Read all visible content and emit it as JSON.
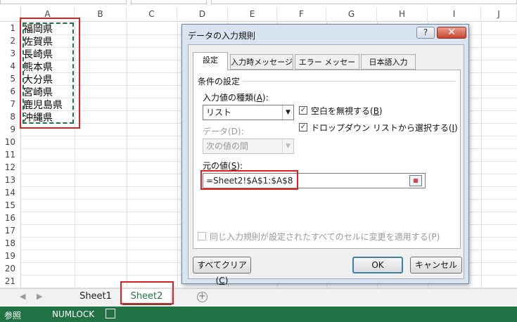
{
  "columns": [
    "A",
    "B",
    "C",
    "D",
    "E",
    "F",
    "G",
    "H",
    "I",
    "J"
  ],
  "rows": [
    "1",
    "2",
    "3",
    "4",
    "5",
    "6",
    "7",
    "8",
    "9",
    "10",
    "11",
    "12",
    "13",
    "14",
    "15",
    "16",
    "17",
    "18",
    "19",
    "20",
    "21"
  ],
  "cells_a": [
    "福岡県",
    "佐賀県",
    "長崎県",
    "熊本県",
    "大分県",
    "宮崎県",
    "鹿児島県",
    "沖縄県"
  ],
  "sheets": [
    "Sheet1",
    "Sheet2"
  ],
  "status": {
    "mode": "参照",
    "numlock": "NUMLOCK"
  },
  "dialog": {
    "title": "データの入力規則",
    "help": "?",
    "close": "✕",
    "tabs": [
      "設定",
      "入力時メッセージ",
      "エラー メッセージ",
      "日本語入力"
    ],
    "section_title": "条件の設定",
    "allow_label": "入力値の種類(",
    "allow_key": "A",
    "allow_value": "リスト",
    "ignore_blank_label": "空白を無視する(",
    "ignore_blank_key": "B",
    "dropdown_label": "ドロップダウン リストから選択する(",
    "dropdown_key": "I",
    "data_label": "データ(D):",
    "data_value": "次の値の間",
    "source_label": "元の値(",
    "source_key": "S",
    "source_value": "=Sheet2!$A$1:$A$8",
    "apply_all_label": "同じ入力規則が設定されたすべてのセルに変更を適用する(P)",
    "clear_all_label": "すべてクリア(",
    "clear_all_key": "C",
    "ok_label": "OK",
    "cancel_label": "キャンセル"
  },
  "colors": {
    "excel_green": "#217346",
    "highlight_red": "#e02020"
  }
}
